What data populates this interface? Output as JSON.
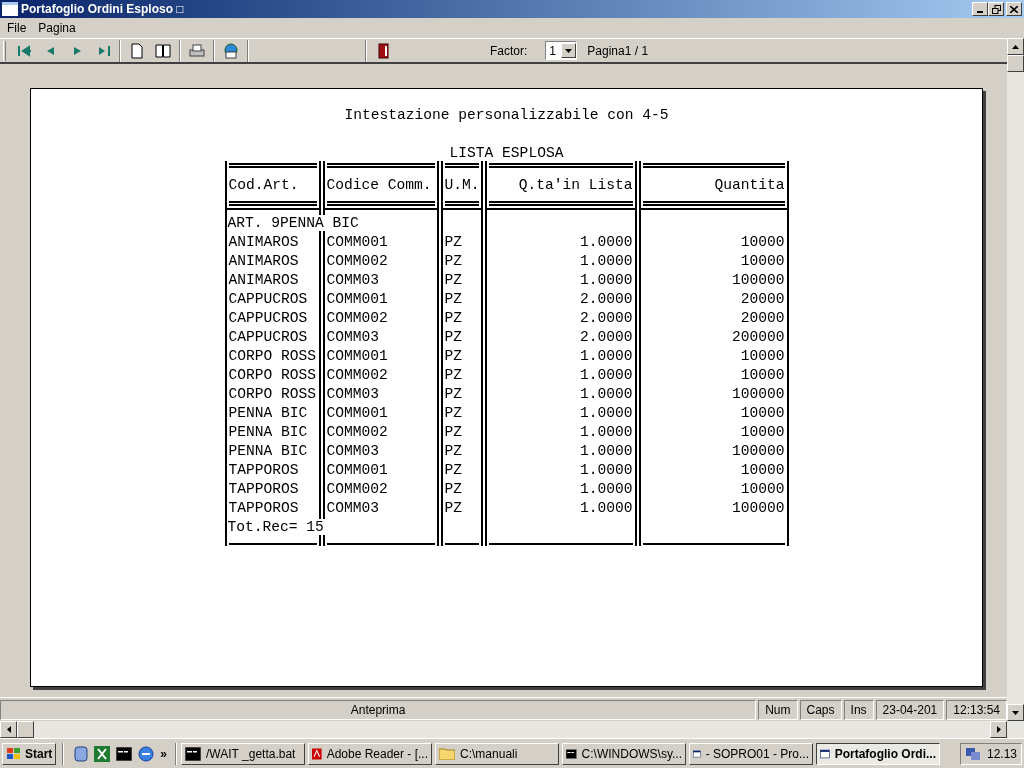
{
  "window": {
    "title": "Portafoglio Ordini Esploso □"
  },
  "menu": [
    "File",
    "Pagina"
  ],
  "toolbar": {
    "factor_label": "Factor:",
    "factor_value": "1",
    "page_label": "Pagina1 / 1"
  },
  "report": {
    "heading": "Intestazione personalizzabile con 4-5",
    "title": "LISTA ESPLOSA",
    "columns": [
      {
        "label": "Cod.Art."
      },
      {
        "label": "Codice Comm."
      },
      {
        "label": "U.M."
      },
      {
        "label": "Q.ta'in Lista"
      },
      {
        "label": "Quantita"
      }
    ],
    "rows": [
      {
        "kind": "group",
        "text": "ART. 9PENNA BIC"
      },
      {
        "kind": "item",
        "cells": [
          "ANIMAROS",
          "COMM001",
          "PZ",
          "1.0000",
          "10000"
        ]
      },
      {
        "kind": "item",
        "cells": [
          "ANIMAROS",
          "COMM002",
          "PZ",
          "1.0000",
          "10000"
        ]
      },
      {
        "kind": "item",
        "cells": [
          "ANIMAROS",
          "COMM03",
          "PZ",
          "1.0000",
          "100000"
        ]
      },
      {
        "kind": "item",
        "cells": [
          "CAPPUCROS",
          "COMM001",
          "PZ",
          "2.0000",
          "20000"
        ]
      },
      {
        "kind": "item",
        "cells": [
          "CAPPUCROS",
          "COMM002",
          "PZ",
          "2.0000",
          "20000"
        ]
      },
      {
        "kind": "item",
        "cells": [
          "CAPPUCROS",
          "COMM03",
          "PZ",
          "2.0000",
          "200000"
        ]
      },
      {
        "kind": "item",
        "cells": [
          "CORPO ROSS",
          "COMM001",
          "PZ",
          "1.0000",
          "10000"
        ]
      },
      {
        "kind": "item",
        "cells": [
          "CORPO ROSS",
          "COMM002",
          "PZ",
          "1.0000",
          "10000"
        ]
      },
      {
        "kind": "item",
        "cells": [
          "CORPO ROSS",
          "COMM03",
          "PZ",
          "1.0000",
          "100000"
        ]
      },
      {
        "kind": "item",
        "cells": [
          "PENNA BIC",
          "COMM001",
          "PZ",
          "1.0000",
          "10000"
        ]
      },
      {
        "kind": "item",
        "cells": [
          "PENNA BIC",
          "COMM002",
          "PZ",
          "1.0000",
          "10000"
        ]
      },
      {
        "kind": "item",
        "cells": [
          "PENNA BIC",
          "COMM03",
          "PZ",
          "1.0000",
          "100000"
        ]
      },
      {
        "kind": "item",
        "cells": [
          "TAPPOROS",
          "COMM001",
          "PZ",
          "1.0000",
          "10000"
        ]
      },
      {
        "kind": "item",
        "cells": [
          "TAPPOROS",
          "COMM002",
          "PZ",
          "1.0000",
          "10000"
        ]
      },
      {
        "kind": "item",
        "cells": [
          "TAPPOROS",
          "COMM03",
          "PZ",
          "1.0000",
          "100000"
        ]
      },
      {
        "kind": "total",
        "text": "Tot.Rec= 15"
      }
    ]
  },
  "status_bar": [
    "Anteprima",
    "Num",
    "Caps",
    "Ins",
    "23-04-201",
    "12:13:54"
  ],
  "taskbar": {
    "start": "Start",
    "more": "»",
    "tasks": [
      {
        "label": "/WAIT _getta.bat",
        "selected": false
      },
      {
        "label": "Adobe Reader - [...",
        "selected": false
      },
      {
        "label": "C:\\manuali",
        "selected": false
      },
      {
        "label": "C:\\WINDOWS\\sy...",
        "selected": false
      },
      {
        "label": "- SOPRO01 - Pro...",
        "selected": false
      },
      {
        "label": "Portafoglio Ordi...",
        "selected": true
      }
    ],
    "clock": "12.13"
  }
}
